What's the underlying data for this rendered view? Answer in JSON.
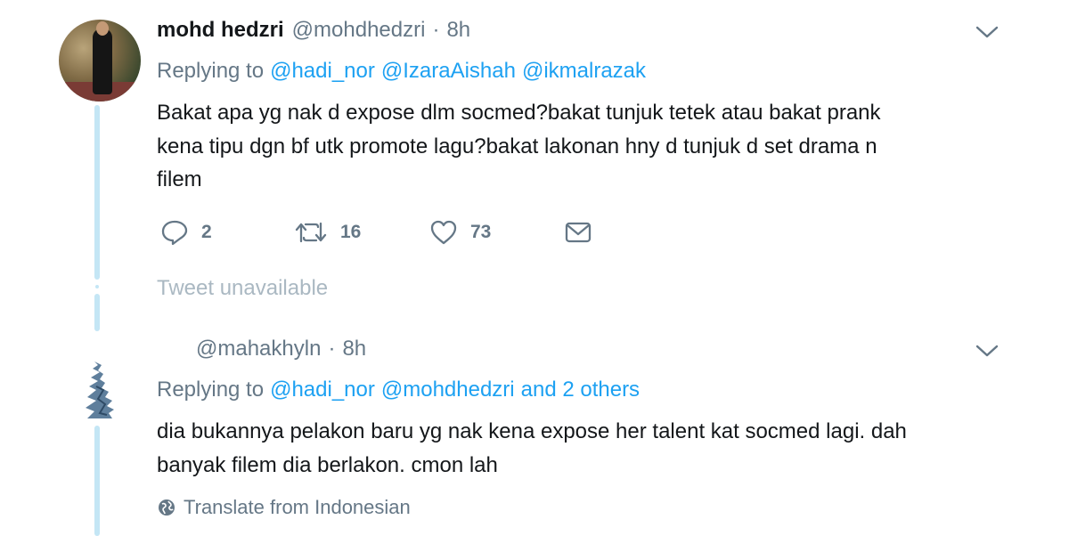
{
  "tweet1": {
    "display_name": "mohd hedzri",
    "handle": "@mohdhedzri",
    "separator": "·",
    "time": "8h",
    "replying_prefix": "Replying to",
    "mentions": [
      "@hadi_nor",
      "@IzaraAishah",
      "@ikmalrazak"
    ],
    "body_lines": [
      "Bakat apa yg nak d expose dlm socmed?bakat tunjuk tetek atau bakat prank",
      "kena tipu dgn bf utk promote lagu?bakat lakonan hny d tunjuk d set drama n",
      "filem"
    ],
    "actions": {
      "reply_count": "2",
      "retweet_count": "16",
      "like_count": "73"
    }
  },
  "unavailable": {
    "text": "Tweet unavailable"
  },
  "tweet2": {
    "handle": "@mahakhyln",
    "separator": "·",
    "time": "8h",
    "replying_prefix": "Replying to",
    "mentions": [
      "@hadi_nor",
      "@mohdhedzri"
    ],
    "others_text": "and 2 others",
    "body_lines": [
      "dia bukannya pelakon baru yg nak kena expose her talent kat socmed lagi. dah",
      "banyak filem dia berlakon. cmon lah"
    ],
    "translate_label": "Translate from Indonesian"
  },
  "colors": {
    "accent": "#1da1f2",
    "muted": "#657786",
    "thread_line": "#c4e6f5",
    "unavailable": "#aab8c2"
  },
  "icons": [
    "reply-icon",
    "retweet-icon",
    "like-icon",
    "direct-message-icon",
    "chevron-down-icon",
    "globe-icon"
  ]
}
